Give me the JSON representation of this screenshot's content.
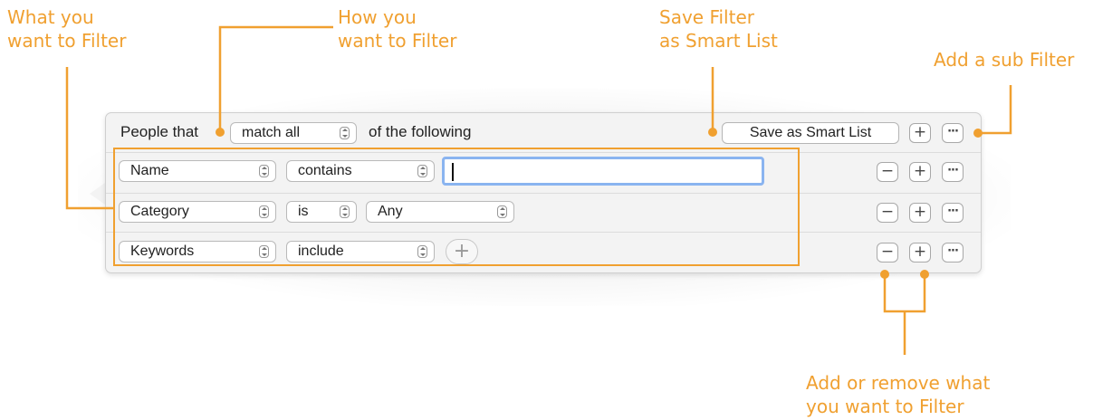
{
  "annotations": {
    "what_to_filter": "What you\nwant to Filter",
    "how_to_filter": "How you\nwant to Filter",
    "save_filter": "Save Filter\nas Smart List",
    "add_sub_filter": "Add a sub Filter",
    "add_remove": "Add or remove what\nyou want to Filter",
    "accent_color": "#f0a030"
  },
  "header": {
    "prefix": "People that",
    "match_value": "match all",
    "suffix": "of the following",
    "save_button": "Save as Smart List",
    "add_icon": "plus",
    "more_icon": "ellipsis"
  },
  "rows": [
    {
      "field": "Name",
      "operator": "contains",
      "value": ""
    },
    {
      "field": "Category",
      "operator": "is",
      "value": "Any"
    },
    {
      "field": "Keywords",
      "operator": "include",
      "add_icon": "plus"
    }
  ],
  "row_buttons": {
    "remove": "−",
    "add": "+",
    "more": "···"
  }
}
